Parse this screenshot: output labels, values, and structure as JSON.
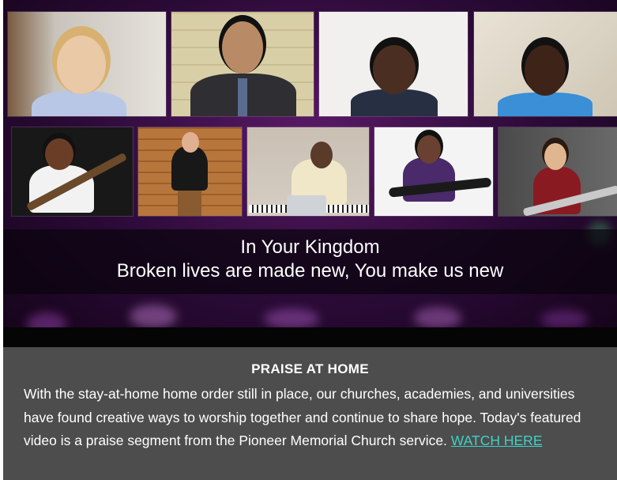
{
  "video": {
    "lyrics_line1": "In Your Kingdom",
    "lyrics_line2": "Broken lives are made new, You make us new"
  },
  "caption": {
    "title": "PRAISE AT HOME",
    "body": "With the stay-at-home home order still in place, our churches, academies, and universities have found creative ways to worship together and continue to share hope. Today's featured video is a praise segment from the Pioneer Memorial Church service.",
    "link_label": "WATCH HERE"
  },
  "colors": {
    "frame_purple": "#5a1a66",
    "caption_bg": "#4d4d4d",
    "link": "#3fd1c7"
  }
}
